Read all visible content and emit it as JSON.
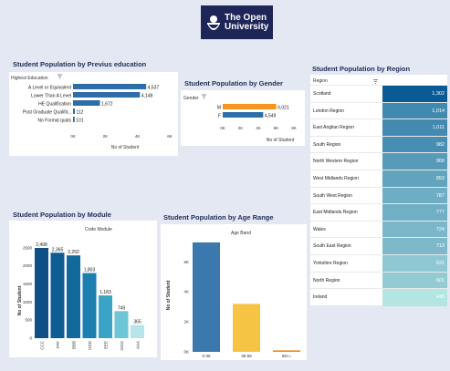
{
  "logo": {
    "line1": "The Open",
    "line2": "University"
  },
  "colors": {
    "edu_bar": "#2e6ea6",
    "gender_bar": "#f7941d",
    "age_0_35": "#3a78ad",
    "age_35_55": "#f6c445",
    "age_55": "#f08b18"
  },
  "education": {
    "title": "Student Population by Previus education",
    "header": "Highest Education",
    "xlabel": "No of Student",
    "ticks": [
      "0K",
      "2K",
      "4K",
      "6K"
    ],
    "chart_data": {
      "type": "bar",
      "orientation": "horizontal",
      "categories": [
        "A Level or Equivalent",
        "Lower Than A Level",
        "HE Qualification",
        "Post Graduate Qualific..",
        "No Formal quals"
      ],
      "values": [
        4537,
        4148,
        1672,
        112,
        101
      ],
      "labels": [
        "4,537",
        "4,148",
        "1,672",
        "112",
        "101"
      ],
      "xlabel": "No of Student",
      "xlim": [
        0,
        6000
      ]
    }
  },
  "gender": {
    "title": "Student Population by Gender",
    "header": "Gender",
    "xlabel": "No of Student",
    "ticks": [
      "0K",
      "2K",
      "4K",
      "6K",
      "8K"
    ],
    "chart_data": {
      "type": "bar",
      "orientation": "horizontal",
      "categories": [
        "M",
        "F"
      ],
      "values": [
        6021,
        4549
      ],
      "labels": [
        "6,021",
        "4,549"
      ],
      "xlabel": "No of Student",
      "xlim": [
        0,
        8000
      ]
    }
  },
  "region": {
    "title": "Student Population by  Region",
    "header": "Region",
    "chart_data": {
      "type": "table",
      "categories": [
        "Scotland",
        "London Region",
        "East Anglian Region",
        "South Region",
        "North Western Region",
        "West Midlands Region",
        "South West Region",
        "East Midlands Region",
        "Wales",
        "South East Region",
        "Yorkshire Region",
        "North Region",
        "Ireland"
      ],
      "values": [
        1302,
        1014,
        1011,
        982,
        900,
        853,
        787,
        777,
        724,
        713,
        621,
        601,
        435
      ],
      "labels": [
        "1,302",
        "1,014",
        "1,011",
        "982",
        "900",
        "853",
        "787",
        "777",
        "724",
        "713",
        "621",
        "601",
        "435"
      ]
    }
  },
  "module": {
    "title": "Student Population by Module",
    "header": "Code Module",
    "ylabel": "No of Student",
    "ticks": [
      "0",
      "500",
      "1000",
      "1500",
      "2000",
      "2500"
    ],
    "chart_data": {
      "type": "bar",
      "categories": [
        "CCC",
        "FFF",
        "BBB",
        "DDD",
        "EEE",
        "GGG",
        "AAA"
      ],
      "values": [
        2498,
        2365,
        2292,
        1803,
        1183,
        749,
        365
      ],
      "labels": [
        "2,498",
        "2,365",
        "2,292",
        "1,803",
        "1,183",
        "749",
        "365"
      ],
      "colors": [
        "#0e4f86",
        "#0d5c92",
        "#11699c",
        "#1b7fb0",
        "#3ba3c6",
        "#6dc6d6",
        "#b7e6ea"
      ],
      "ylabel": "No of Student",
      "ylim": [
        0,
        2700
      ]
    }
  },
  "age": {
    "title": "Student Population by Age Range",
    "header": "Age Band",
    "ylabel": "No of Student",
    "ticks": [
      "0K",
      "2K",
      "4K",
      "6K"
    ],
    "chart_data": {
      "type": "bar",
      "categories": [
        "0-35",
        "35-55",
        "55<="
      ],
      "values": [
        7300,
        3200,
        100
      ],
      "ylabel": "No of Student",
      "ylim": [
        0,
        7600
      ]
    }
  }
}
